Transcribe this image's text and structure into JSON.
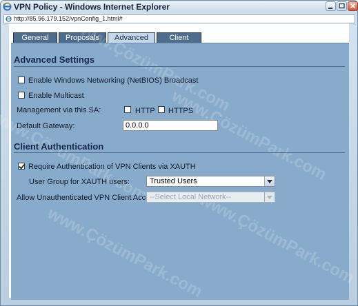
{
  "window": {
    "title": "VPN Policy - Windows Internet Explorer",
    "address": "http://85.96.179.152/vpnConfig_1.html#"
  },
  "tabs": [
    {
      "label": "General"
    },
    {
      "label": "Proposals"
    },
    {
      "label": "Advanced"
    },
    {
      "label": "Client"
    }
  ],
  "active_tab": "Advanced",
  "advanced": {
    "title": "Advanced Settings",
    "netbios_label": "Enable Windows Networking (NetBIOS) Broadcast",
    "netbios_checked": false,
    "multicast_label": "Enable Multicast",
    "multicast_checked": false,
    "management_label": "Management via this SA:",
    "http_label": "HTTP",
    "http_checked": false,
    "https_label": "HTTPS",
    "https_checked": false,
    "gateway_label": "Default Gateway:",
    "gateway_value": "0.0.0.0"
  },
  "client_auth": {
    "title": "Client Authentication",
    "require_xauth_label": "Require Authentication of VPN Clients via XAUTH",
    "require_xauth_checked": true,
    "user_group_label": "User Group for XAUTH users:",
    "user_group_value": "Trusted Users",
    "unauth_label": "Allow Unauthenticated VPN Client Access:",
    "unauth_value": "--Select Local Network--"
  },
  "watermark": "www.ÇözümPark.com"
}
